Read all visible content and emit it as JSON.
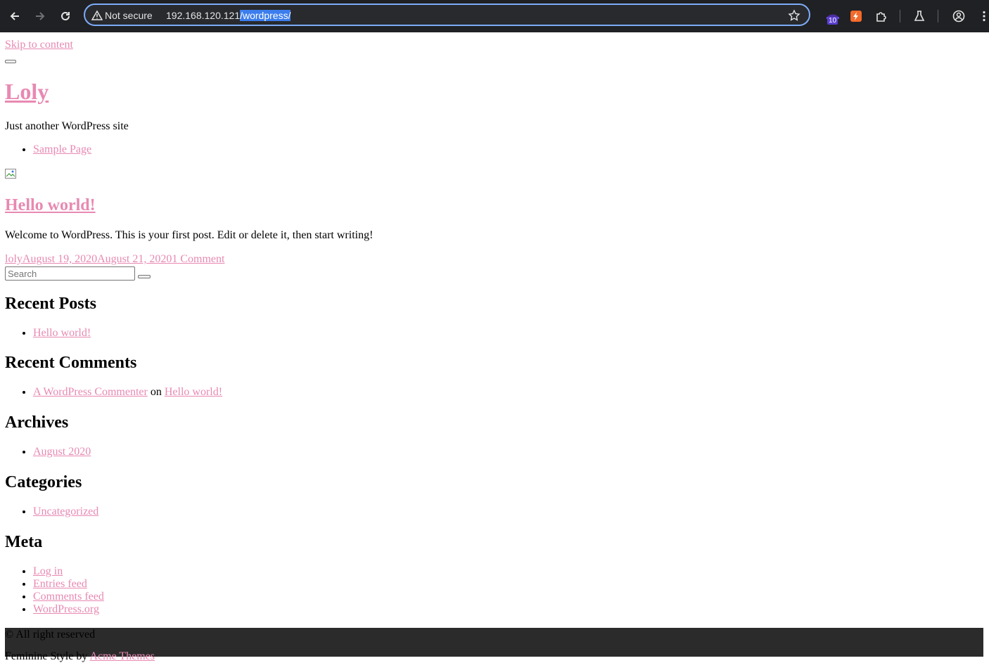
{
  "browser": {
    "security_label": "Not secure",
    "url_host": "192.168.120.121",
    "url_path": "/wordpress/",
    "extension_badge": "10"
  },
  "site": {
    "skip_link": "Skip to content",
    "title": "Loly",
    "tagline": "Just another WordPress site",
    "nav": [
      "Sample Page"
    ]
  },
  "post": {
    "title": "Hello world!",
    "excerpt": "Welcome to WordPress. This is your first post. Edit or delete it, then start writing!",
    "author": "loly",
    "published": "August 19, 2020",
    "updated": "August 21, 2020",
    "comments": "1 Comment"
  },
  "search": {
    "placeholder": "Search"
  },
  "widgets": {
    "recent_posts": {
      "heading": "Recent Posts",
      "items": [
        "Hello world!"
      ]
    },
    "recent_comments": {
      "heading": "Recent Comments",
      "author": "A WordPress Commenter",
      "joiner": "on",
      "post": "Hello world!"
    },
    "archives": {
      "heading": "Archives",
      "items": [
        "August 2020"
      ]
    },
    "categories": {
      "heading": "Categories",
      "items": [
        "Uncategorized"
      ]
    },
    "meta": {
      "heading": "Meta",
      "items": [
        "Log in",
        "Entries feed",
        "Comments feed",
        "WordPress.org"
      ]
    }
  },
  "footer": {
    "copyright": "© All right reserved",
    "credit_prefix": "Feminine Style by",
    "credit_link": "Acme Themes"
  },
  "colors": {
    "link": "#e889b2",
    "chrome_bg": "#202124",
    "omnibox_border": "#7cacf8",
    "url_selection": "#3b7ded",
    "footer_bg": "#2b2b2b"
  }
}
